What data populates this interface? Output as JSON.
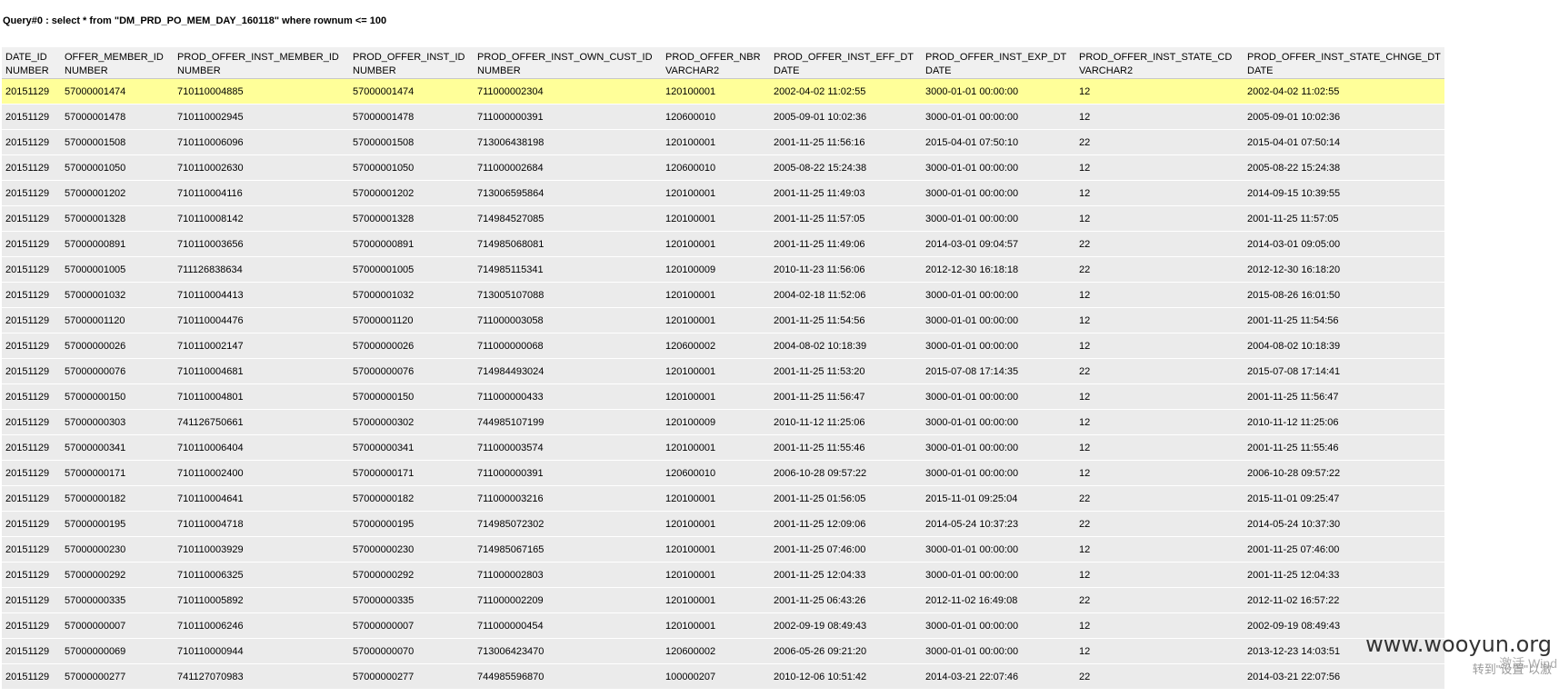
{
  "query": "Query#0 : select * from \"DM_PRD_PO_MEM_DAY_160118\" where rownum <= 100",
  "columns": [
    {
      "name": "DATE_ID",
      "type": "NUMBER"
    },
    {
      "name": "OFFER_MEMBER_ID",
      "type": "NUMBER"
    },
    {
      "name": "PROD_OFFER_INST_MEMBER_ID",
      "type": "NUMBER"
    },
    {
      "name": "PROD_OFFER_INST_ID",
      "type": "NUMBER"
    },
    {
      "name": "PROD_OFFER_INST_OWN_CUST_ID",
      "type": "NUMBER"
    },
    {
      "name": "PROD_OFFER_NBR",
      "type": "VARCHAR2"
    },
    {
      "name": "PROD_OFFER_INST_EFF_DT",
      "type": "DATE"
    },
    {
      "name": "PROD_OFFER_INST_EXP_DT",
      "type": "DATE"
    },
    {
      "name": "PROD_OFFER_INST_STATE_CD",
      "type": "VARCHAR2"
    },
    {
      "name": "PROD_OFFER_INST_STATE_CHNGE_DT",
      "type": "DATE"
    }
  ],
  "rows": [
    [
      "20151129",
      "57000001474",
      "710110004885",
      "57000001474",
      "711000002304",
      "120100001",
      "2002-04-02 11:02:55",
      "3000-01-01 00:00:00",
      "12",
      "2002-04-02 11:02:55"
    ],
    [
      "20151129",
      "57000001478",
      "710110002945",
      "57000001478",
      "711000000391",
      "120600010",
      "2005-09-01 10:02:36",
      "3000-01-01 00:00:00",
      "12",
      "2005-09-01 10:02:36"
    ],
    [
      "20151129",
      "57000001508",
      "710110006096",
      "57000001508",
      "713006438198",
      "120100001",
      "2001-11-25 11:56:16",
      "2015-04-01 07:50:10",
      "22",
      "2015-04-01 07:50:14"
    ],
    [
      "20151129",
      "57000001050",
      "710110002630",
      "57000001050",
      "711000002684",
      "120600010",
      "2005-08-22 15:24:38",
      "3000-01-01 00:00:00",
      "12",
      "2005-08-22 15:24:38"
    ],
    [
      "20151129",
      "57000001202",
      "710110004116",
      "57000001202",
      "713006595864",
      "120100001",
      "2001-11-25 11:49:03",
      "3000-01-01 00:00:00",
      "12",
      "2014-09-15 10:39:55"
    ],
    [
      "20151129",
      "57000001328",
      "710110008142",
      "57000001328",
      "714984527085",
      "120100001",
      "2001-11-25 11:57:05",
      "3000-01-01 00:00:00",
      "12",
      "2001-11-25 11:57:05"
    ],
    [
      "20151129",
      "57000000891",
      "710110003656",
      "57000000891",
      "714985068081",
      "120100001",
      "2001-11-25 11:49:06",
      "2014-03-01 09:04:57",
      "22",
      "2014-03-01 09:05:00"
    ],
    [
      "20151129",
      "57000001005",
      "711126838634",
      "57000001005",
      "714985115341",
      "120100009",
      "2010-11-23 11:56:06",
      "2012-12-30 16:18:18",
      "22",
      "2012-12-30 16:18:20"
    ],
    [
      "20151129",
      "57000001032",
      "710110004413",
      "57000001032",
      "713005107088",
      "120100001",
      "2004-02-18 11:52:06",
      "3000-01-01 00:00:00",
      "12",
      "2015-08-26 16:01:50"
    ],
    [
      "20151129",
      "57000001120",
      "710110004476",
      "57000001120",
      "711000003058",
      "120100001",
      "2001-11-25 11:54:56",
      "3000-01-01 00:00:00",
      "12",
      "2001-11-25 11:54:56"
    ],
    [
      "20151129",
      "57000000026",
      "710110002147",
      "57000000026",
      "711000000068",
      "120600002",
      "2004-08-02 10:18:39",
      "3000-01-01 00:00:00",
      "12",
      "2004-08-02 10:18:39"
    ],
    [
      "20151129",
      "57000000076",
      "710110004681",
      "57000000076",
      "714984493024",
      "120100001",
      "2001-11-25 11:53:20",
      "2015-07-08 17:14:35",
      "22",
      "2015-07-08 17:14:41"
    ],
    [
      "20151129",
      "57000000150",
      "710110004801",
      "57000000150",
      "711000000433",
      "120100001",
      "2001-11-25 11:56:47",
      "3000-01-01 00:00:00",
      "12",
      "2001-11-25 11:56:47"
    ],
    [
      "20151129",
      "57000000303",
      "741126750661",
      "57000000302",
      "744985107199",
      "120100009",
      "2010-11-12 11:25:06",
      "3000-01-01 00:00:00",
      "12",
      "2010-11-12 11:25:06"
    ],
    [
      "20151129",
      "57000000341",
      "710110006404",
      "57000000341",
      "711000003574",
      "120100001",
      "2001-11-25 11:55:46",
      "3000-01-01 00:00:00",
      "12",
      "2001-11-25 11:55:46"
    ],
    [
      "20151129",
      "57000000171",
      "710110002400",
      "57000000171",
      "711000000391",
      "120600010",
      "2006-10-28 09:57:22",
      "3000-01-01 00:00:00",
      "12",
      "2006-10-28 09:57:22"
    ],
    [
      "20151129",
      "57000000182",
      "710110004641",
      "57000000182",
      "711000003216",
      "120100001",
      "2001-11-25 01:56:05",
      "2015-11-01 09:25:04",
      "22",
      "2015-11-01 09:25:47"
    ],
    [
      "20151129",
      "57000000195",
      "710110004718",
      "57000000195",
      "714985072302",
      "120100001",
      "2001-11-25 12:09:06",
      "2014-05-24 10:37:23",
      "22",
      "2014-05-24 10:37:30"
    ],
    [
      "20151129",
      "57000000230",
      "710110003929",
      "57000000230",
      "714985067165",
      "120100001",
      "2001-11-25 07:46:00",
      "3000-01-01 00:00:00",
      "12",
      "2001-11-25 07:46:00"
    ],
    [
      "20151129",
      "57000000292",
      "710110006325",
      "57000000292",
      "711000002803",
      "120100001",
      "2001-11-25 12:04:33",
      "3000-01-01 00:00:00",
      "12",
      "2001-11-25 12:04:33"
    ],
    [
      "20151129",
      "57000000335",
      "710110005892",
      "57000000335",
      "711000002209",
      "120100001",
      "2001-11-25 06:43:26",
      "2012-11-02 16:49:08",
      "22",
      "2012-11-02 16:57:22"
    ],
    [
      "20151129",
      "57000000007",
      "710110006246",
      "57000000007",
      "711000000454",
      "120100001",
      "2002-09-19 08:49:43",
      "3000-01-01 00:00:00",
      "12",
      "2002-09-19 08:49:43"
    ],
    [
      "20151129",
      "57000000069",
      "710110000944",
      "57000000070",
      "713006423470",
      "120600002",
      "2006-05-26 09:21:20",
      "3000-01-01 00:00:00",
      "12",
      "2013-12-23 14:03:51"
    ],
    [
      "20151129",
      "57000000277",
      "741127070983",
      "57000000277",
      "744985596870",
      "100000207",
      "2010-12-06 10:51:42",
      "2014-03-21 22:07:46",
      "22",
      "2014-03-21 22:07:56"
    ]
  ],
  "selected_row": 0,
  "watermark": "www.wooyun.org",
  "watermark_ghost": "激活 Wind",
  "watermark_ghost2": "转到\"设置\"以激"
}
